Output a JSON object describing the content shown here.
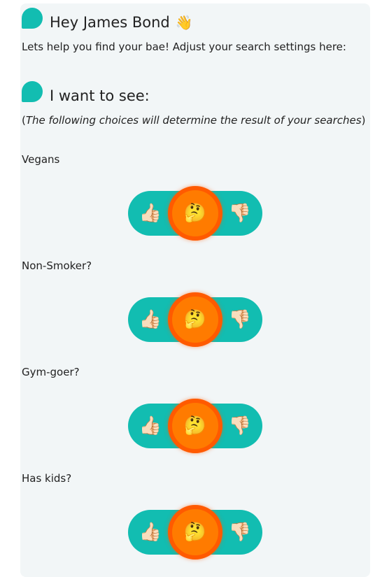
{
  "greeting": {
    "title": "Hey James Bond",
    "emoji": "👋",
    "subtitle": "Lets help you find your bae! Adjust your search settings here:"
  },
  "section": {
    "title": "I want to see:",
    "note_open": "(",
    "note_text": "The following choices will determine the result of your searches",
    "note_close": ")"
  },
  "colors": {
    "accent": "#12bdb1",
    "knob": "#ff7b00",
    "panel": "#f2f6f7"
  },
  "questions": [
    {
      "label": "Vegans",
      "like": "👍🏻",
      "neutral": "🤔",
      "dislike": "👎🏻",
      "selected": "neutral"
    },
    {
      "label": "Non-Smoker?",
      "like": "👍🏻",
      "neutral": "🤔",
      "dislike": "👎🏻",
      "selected": "neutral"
    },
    {
      "label": "Gym-goer?",
      "like": "👍🏻",
      "neutral": "🤔",
      "dislike": "👎🏻",
      "selected": "neutral"
    },
    {
      "label": "Has kids?",
      "like": "👍🏻",
      "neutral": "🤔",
      "dislike": "👎🏻",
      "selected": "neutral"
    }
  ]
}
